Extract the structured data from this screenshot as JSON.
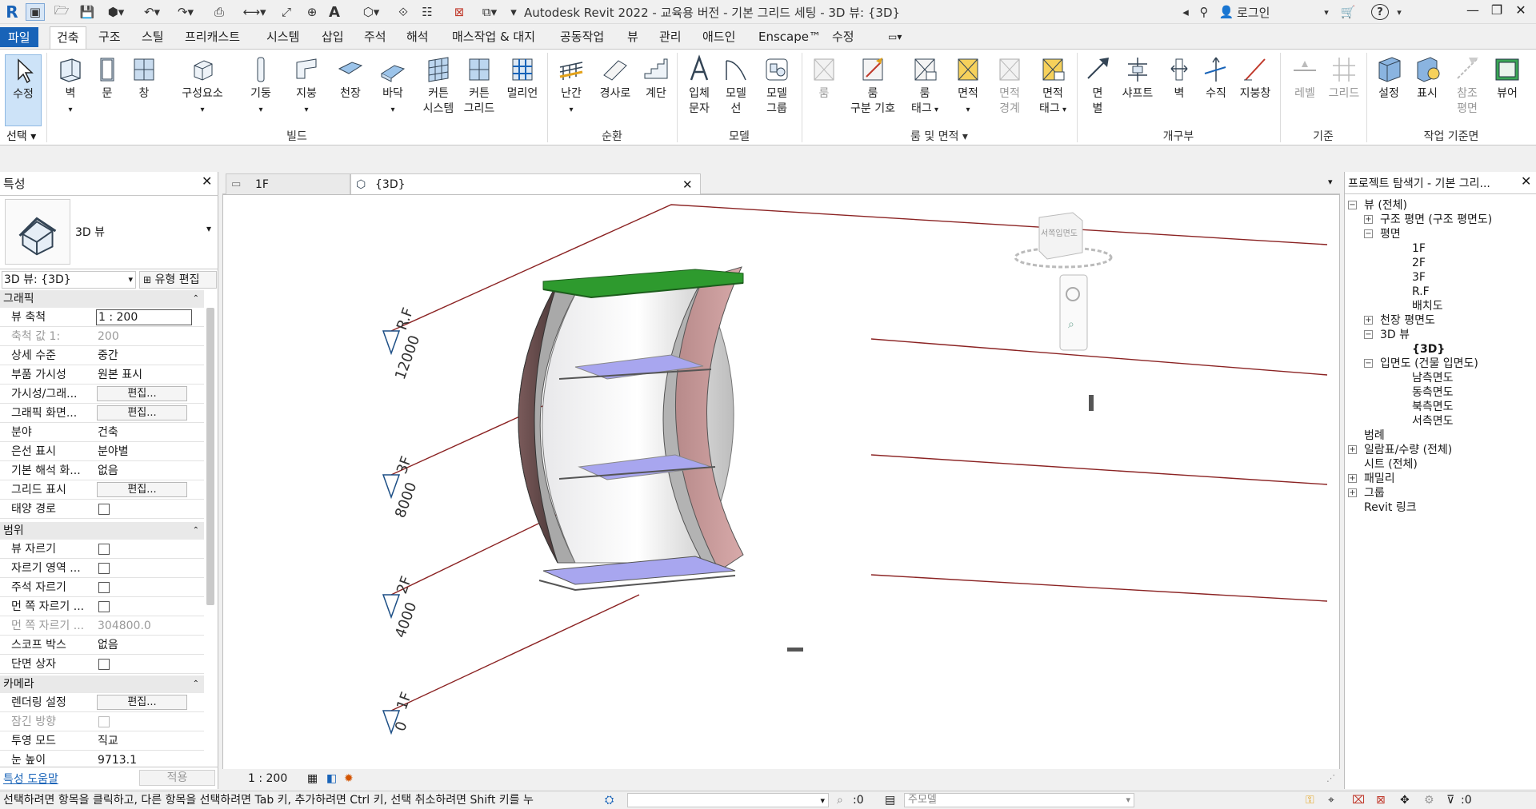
{
  "window": {
    "title": "Autodesk Revit 2022 - 교육용 버전 - 기본 그리드 세팅 - 3D 뷰: {3D}",
    "login": "로그인",
    "help": "?"
  },
  "menu": {
    "file": "파일",
    "tabs": [
      "건축",
      "구조",
      "스틸",
      "프리캐스트",
      "시스템",
      "삽입",
      "주석",
      "해석",
      "매스작업 & 대지",
      "공동작업",
      "뷰",
      "관리",
      "애드인",
      "Enscape™",
      "수정"
    ]
  },
  "ribbon": {
    "select_label": "선택",
    "buttons": [
      {
        "id": "modify",
        "l1": "수정",
        "l2": ""
      },
      {
        "id": "wall",
        "l1": "벽",
        "l2": ""
      },
      {
        "id": "door",
        "l1": "문",
        "l2": ""
      },
      {
        "id": "window",
        "l1": "창",
        "l2": ""
      },
      {
        "id": "component",
        "l1": "구성요소",
        "l2": ""
      },
      {
        "id": "column",
        "l1": "기둥",
        "l2": ""
      },
      {
        "id": "roof",
        "l1": "지붕",
        "l2": ""
      },
      {
        "id": "ceiling",
        "l1": "천장",
        "l2": ""
      },
      {
        "id": "floor",
        "l1": "바닥",
        "l2": ""
      },
      {
        "id": "curtain-system",
        "l1": "커튼",
        "l2": "시스템"
      },
      {
        "id": "curtain-grid",
        "l1": "커튼",
        "l2": "그리드"
      },
      {
        "id": "mullion",
        "l1": "멀리언",
        "l2": ""
      },
      {
        "id": "railing",
        "l1": "난간",
        "l2": ""
      },
      {
        "id": "ramp",
        "l1": "경사로",
        "l2": ""
      },
      {
        "id": "stair",
        "l1": "계단",
        "l2": ""
      },
      {
        "id": "model-text",
        "l1": "입체",
        "l2": "문자"
      },
      {
        "id": "model-line",
        "l1": "모델",
        "l2": "선"
      },
      {
        "id": "model-group",
        "l1": "모델",
        "l2": "그룹"
      },
      {
        "id": "room",
        "l1": "룸",
        "l2": ""
      },
      {
        "id": "room-separator",
        "l1": "룸",
        "l2": "구분 기호"
      },
      {
        "id": "room-tag",
        "l1": "룸",
        "l2": "태그"
      },
      {
        "id": "area",
        "l1": "면적",
        "l2": ""
      },
      {
        "id": "area-boundary",
        "l1": "면적",
        "l2": "경계"
      },
      {
        "id": "area-tag",
        "l1": "면적",
        "l2": "태그"
      },
      {
        "id": "by-face",
        "l1": "면",
        "l2": "별"
      },
      {
        "id": "shaft",
        "l1": "샤프트",
        "l2": ""
      },
      {
        "id": "opening-wall",
        "l1": "벽",
        "l2": ""
      },
      {
        "id": "vertical",
        "l1": "수직",
        "l2": ""
      },
      {
        "id": "dormer",
        "l1": "지붕창",
        "l2": ""
      },
      {
        "id": "level",
        "l1": "레벨",
        "l2": ""
      },
      {
        "id": "grid",
        "l1": "그리드",
        "l2": ""
      },
      {
        "id": "set",
        "l1": "설정",
        "l2": ""
      },
      {
        "id": "show",
        "l1": "표시",
        "l2": ""
      },
      {
        "id": "ref-plane",
        "l1": "참조",
        "l2": "평면"
      },
      {
        "id": "viewer",
        "l1": "뷰어",
        "l2": ""
      }
    ],
    "panels": [
      "빌드",
      "순환",
      "모델",
      "룸 및 면적",
      "개구부",
      "기준",
      "작업 기준면"
    ]
  },
  "properties": {
    "title": "특성",
    "type_name": "3D 뷰",
    "selector": "3D 뷰: {3D}",
    "edit_type": "유형 편집",
    "sections": {
      "graphics": "그래픽",
      "extents": "범위",
      "camera": "카메라"
    },
    "rows": [
      {
        "k": "뷰 축척",
        "v": "1 : 200",
        "kind": "input"
      },
      {
        "k": "축척 값    1:",
        "v": "200",
        "kind": "dis"
      },
      {
        "k": "상세 수준",
        "v": "중간",
        "kind": "text"
      },
      {
        "k": "부품 가시성",
        "v": "원본 표시",
        "kind": "text"
      },
      {
        "k": "가시성/그래...",
        "v": "편집...",
        "kind": "btn"
      },
      {
        "k": "그래픽 화면...",
        "v": "편집...",
        "kind": "btn"
      },
      {
        "k": "분야",
        "v": "건축",
        "kind": "text"
      },
      {
        "k": "은선 표시",
        "v": "분야별",
        "kind": "text"
      },
      {
        "k": "기본 해석 화...",
        "v": "없음",
        "kind": "text"
      },
      {
        "k": "그리드 표시",
        "v": "편집...",
        "kind": "btn"
      },
      {
        "k": "태양 경로",
        "v": "",
        "kind": "check"
      },
      {
        "k": "뷰 자르기",
        "v": "",
        "kind": "check"
      },
      {
        "k": "자르기 영역 ...",
        "v": "",
        "kind": "check"
      },
      {
        "k": "주석 자르기",
        "v": "",
        "kind": "check"
      },
      {
        "k": "먼 쪽 자르기 ...",
        "v": "",
        "kind": "check"
      },
      {
        "k": "먼 쪽 자르기 ...",
        "v": "304800.0",
        "kind": "dis"
      },
      {
        "k": "스코프 박스",
        "v": "없음",
        "kind": "text"
      },
      {
        "k": "단면 상자",
        "v": "",
        "kind": "check"
      },
      {
        "k": "렌더링 설정",
        "v": "편집...",
        "kind": "btn"
      },
      {
        "k": "잠긴 방향",
        "v": "",
        "kind": "checkdis"
      },
      {
        "k": "투영 모드",
        "v": "직교",
        "kind": "text"
      },
      {
        "k": "눈 높이",
        "v": "9713.1",
        "kind": "text"
      }
    ],
    "help_link": "특성 도움말",
    "apply": "적용"
  },
  "views": {
    "tabs": [
      "1F",
      "{3D}"
    ]
  },
  "viewport": {
    "levels": [
      {
        "name": "R.F",
        "elev": "12000"
      },
      {
        "name": "3F",
        "elev": "8000"
      },
      {
        "name": "2F",
        "elev": "4000"
      },
      {
        "name": "1F",
        "elev": "0"
      }
    ],
    "viewcube_label": "서쪽입면도",
    "scale": "1 : 200"
  },
  "browser": {
    "title": "프로젝트 탐색기 - 기본 그리...",
    "nodes": [
      {
        "t": "뷰 (전체)",
        "d": 0,
        "e": "-"
      },
      {
        "t": "구조 평면 (구조 평면도)",
        "d": 1,
        "e": "+"
      },
      {
        "t": "평면",
        "d": 1,
        "e": "-"
      },
      {
        "t": "1F",
        "d": 2,
        "e": ""
      },
      {
        "t": "2F",
        "d": 2,
        "e": ""
      },
      {
        "t": "3F",
        "d": 2,
        "e": ""
      },
      {
        "t": "R.F",
        "d": 2,
        "e": ""
      },
      {
        "t": "배치도",
        "d": 2,
        "e": ""
      },
      {
        "t": "천장 평면도",
        "d": 1,
        "e": "+"
      },
      {
        "t": "3D 뷰",
        "d": 1,
        "e": "-"
      },
      {
        "t": "{3D}",
        "d": 2,
        "e": "",
        "bold": true
      },
      {
        "t": "입면도 (건물 입면도)",
        "d": 1,
        "e": "-"
      },
      {
        "t": "남측면도",
        "d": 2,
        "e": ""
      },
      {
        "t": "동측면도",
        "d": 2,
        "e": ""
      },
      {
        "t": "북측면도",
        "d": 2,
        "e": ""
      },
      {
        "t": "서측면도",
        "d": 2,
        "e": ""
      },
      {
        "t": "범례",
        "d": 0,
        "e": ""
      },
      {
        "t": "일람표/수량 (전체)",
        "d": 0,
        "e": "+"
      },
      {
        "t": "시트 (전체)",
        "d": 0,
        "e": ""
      },
      {
        "t": "패밀리",
        "d": 0,
        "e": "+"
      },
      {
        "t": "그룹",
        "d": 0,
        "e": "+"
      },
      {
        "t": "Revit 링크",
        "d": 0,
        "e": ""
      }
    ]
  },
  "status": {
    "hint": "선택하려면 항목을 클릭하고, 다른 항목을 선택하려면 Tab 키, 추가하려면 Ctrl 키, 선택 취소하려면 Shift 키를 누",
    "zero": ":0",
    "model": "주모델",
    "filter": ":0"
  }
}
